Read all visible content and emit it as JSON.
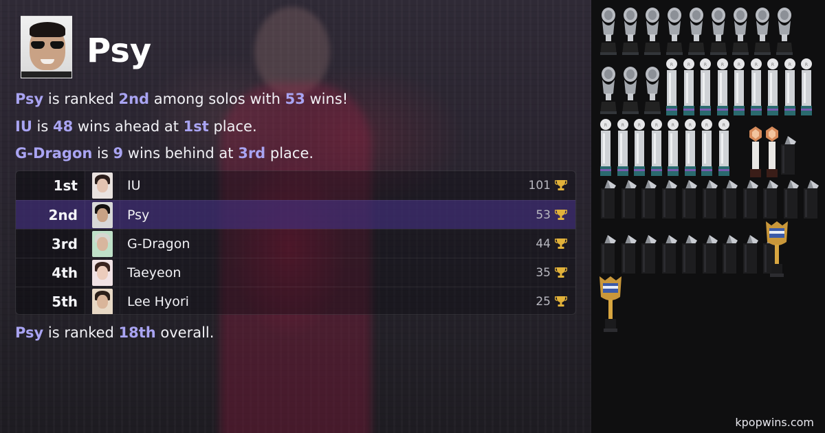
{
  "artist": {
    "name": "Psy",
    "photo_icon": "artist-portrait"
  },
  "summary": {
    "line1": {
      "subject": "Psy",
      "t1": " is ranked ",
      "rank": "2nd",
      "t2": " among solos with ",
      "wins": "53",
      "t3": " wins!"
    },
    "line2": {
      "subject": "IU",
      "t1": " is ",
      "diff": "48",
      "t2": " wins ahead at ",
      "rank": "1st",
      "t3": " place."
    },
    "line3": {
      "subject": "G-Dragon",
      "t1": " is ",
      "diff": "9",
      "t2": " wins behind at ",
      "rank": "3rd",
      "t3": " place."
    },
    "overall": {
      "subject": "Psy",
      "t1": " is ranked ",
      "rank": "18th",
      "t2": " overall."
    }
  },
  "ranking": {
    "rows": [
      {
        "rank": "1st",
        "name": "IU",
        "wins": "101",
        "current": false
      },
      {
        "rank": "2nd",
        "name": "Psy",
        "wins": "53",
        "current": true
      },
      {
        "rank": "3rd",
        "name": "G-Dragon",
        "wins": "44",
        "current": false
      },
      {
        "rank": "4th",
        "name": "Taeyeon",
        "wins": "35",
        "current": false
      },
      {
        "rank": "5th",
        "name": "Lee Hyori",
        "wins": "25",
        "current": false
      }
    ]
  },
  "trophy_wall": {
    "groups": [
      {
        "show": "silver-bust-trophy",
        "count": 12
      },
      {
        "show": "glass-column-trophy",
        "count": 17
      },
      {
        "show": "bronze-crystal-trophy",
        "count": 2
      },
      {
        "show": "black-crystal-award",
        "count": 20
      },
      {
        "show": "gold-show-trophy",
        "count": 2
      }
    ]
  },
  "colors": {
    "highlight": "#a9a4f2",
    "current_row": "#46328a",
    "trophy_gold": "#e2b23a"
  },
  "footer": {
    "site": "kpopwins.com"
  }
}
